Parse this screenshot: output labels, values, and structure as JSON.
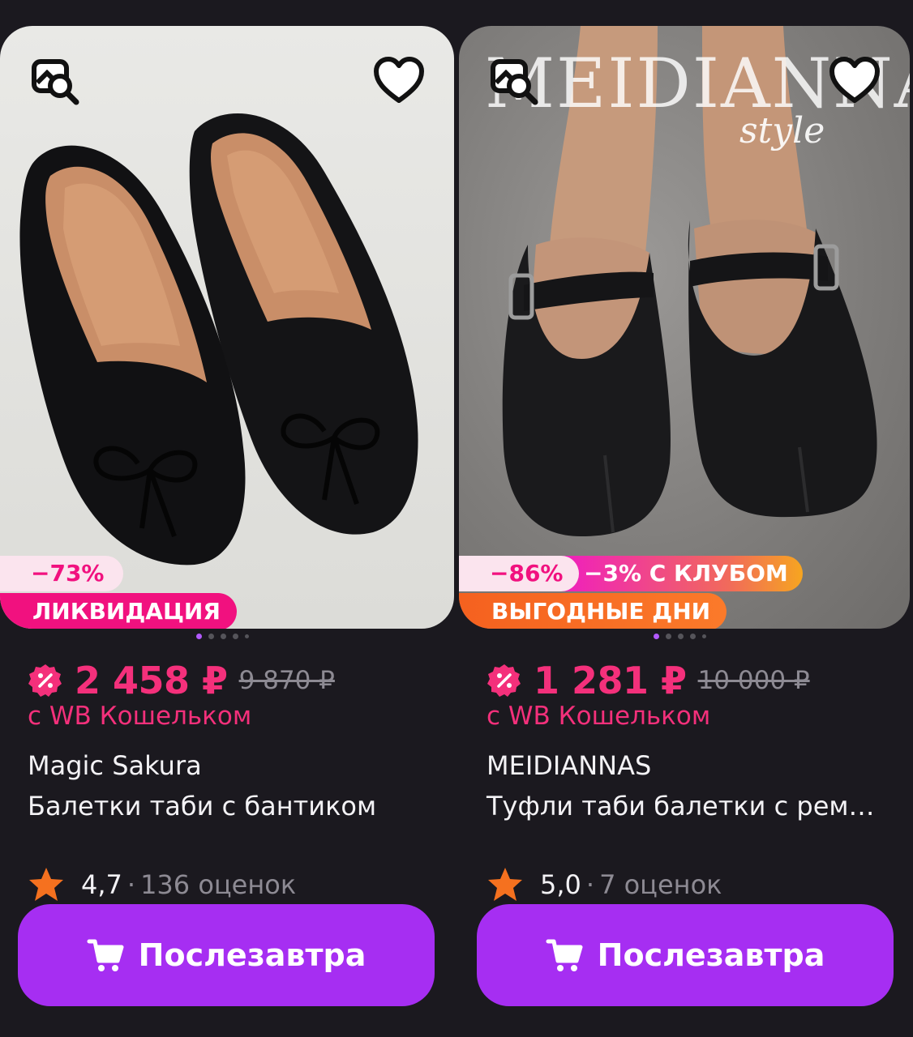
{
  "colors": {
    "background": "#1b191f",
    "price": "#f4307b",
    "button": "#a62ef2",
    "star": "#f5711f",
    "discount_text": "#f1117f"
  },
  "cards": [
    {
      "discount_badge": "−73%",
      "promo_badge": "ЛИКВИДАЦИЯ",
      "price": "2 458 ₽",
      "old_price": "9 870 ₽",
      "wallet_note": "с WB Кошельком",
      "brand": "Magic Sakura",
      "title": "Балетки таби с бантиком",
      "rating": "4,7",
      "separator": "·",
      "reviews": "136 оценок",
      "button_label": "Послезавтра",
      "images_count": 5,
      "active_image": 1,
      "icons": [
        "search-image-icon",
        "heart-icon",
        "wallet-discount-icon",
        "star-icon",
        "cart-icon"
      ]
    },
    {
      "watermark_brand": "MEIDIANNAS",
      "watermark_style": "style",
      "discount_badge": "−86%",
      "club_badge": "−3% С КЛУБОМ",
      "promo_badge": "ВЫГОДНЫЕ ДНИ",
      "price": "1 281 ₽",
      "old_price": "10 000 ₽",
      "wallet_note": "с WB Кошельком",
      "brand": "MEIDIANNAS",
      "title": "Туфли таби балетки с рем…",
      "rating": "5,0",
      "separator": "·",
      "reviews": "7 оценок",
      "button_label": "Послезавтра",
      "images_count": 5,
      "active_image": 1,
      "icons": [
        "search-image-icon",
        "heart-icon",
        "wallet-discount-icon",
        "star-icon",
        "cart-icon"
      ]
    }
  ]
}
